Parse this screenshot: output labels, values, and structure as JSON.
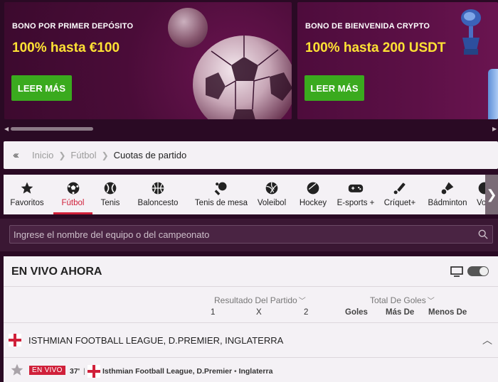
{
  "banners": [
    {
      "kicker": "BONO POR PRIMER DEPÓSITO",
      "amount": "100% hasta €100",
      "cta": "LEER MÁS"
    },
    {
      "kicker": "BONO DE BIENVENIDA CRYPTO",
      "amount": "100% hasta 200 USDT",
      "cta": "LEER MÁS"
    }
  ],
  "breadcrumb": {
    "items": [
      "Inicio",
      "Fútbol",
      "Cuotas de partido"
    ]
  },
  "sports": [
    {
      "label": "Favoritos",
      "icon": "star-icon"
    },
    {
      "label": "Fútbol",
      "icon": "soccer-ball-icon",
      "active": true
    },
    {
      "label": "Tenis",
      "icon": "tennis-ball-icon"
    },
    {
      "label": "Baloncesto",
      "icon": "basketball-icon"
    },
    {
      "label": "Tenis de mesa",
      "icon": "table-tennis-icon"
    },
    {
      "label": "Voleibol",
      "icon": "volleyball-icon"
    },
    {
      "label": "Hockey",
      "icon": "hockey-puck-icon"
    },
    {
      "label": "E-sports +",
      "icon": "gamepad-icon"
    },
    {
      "label": "Críquet+",
      "icon": "cricket-icon"
    },
    {
      "label": "Bádminton",
      "icon": "shuttlecock-icon"
    },
    {
      "label": "Vole",
      "icon": "volleyball-icon"
    }
  ],
  "search": {
    "placeholder": "Ingrese el nombre del equipo o del campeonato"
  },
  "live": {
    "title": "EN VIVO AHORA",
    "market_result": "Resultado Del Partido",
    "market_goals": "Total De Goles",
    "cols": {
      "one": "1",
      "x": "X",
      "two": "2",
      "goles": "Goles",
      "mas": "Más De",
      "menos": "Menos De"
    },
    "league": "ISTHMIAN FOOTBALL LEAGUE, D.PREMIER, INGLATERRA",
    "match": {
      "badge": "EN VIVO",
      "minute": "37'",
      "separator": "|",
      "league": "Isthmian Football League, D.Premier",
      "country": "Inglaterra"
    }
  },
  "colors": {
    "accent": "#d0203a",
    "cta": "#3aaa1e",
    "promo_yellow": "#ffe234",
    "dark_bg": "#2a0a24"
  }
}
